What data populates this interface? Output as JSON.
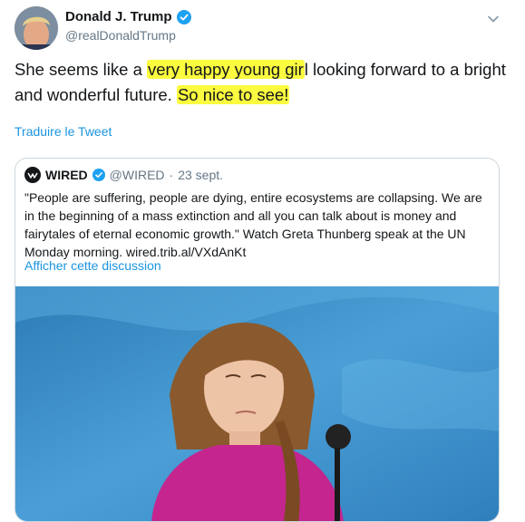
{
  "author": {
    "name": "Donald J. Trump",
    "handle": "@realDonaldTrump"
  },
  "tweet": {
    "part1": "She seems like a ",
    "highlight1": "very happy young gir",
    "part2": "l looking forward to a bright and wonderful future. ",
    "highlight2": "So nice to see!"
  },
  "translate_label": "Traduire le Tweet",
  "quoted": {
    "name": "WIRED",
    "handle": "@WIRED",
    "separator": "·",
    "date": "23 sept.",
    "text": "\"People are suffering, people are dying, entire ecosystems are collapsing. We are in the beginning of a mass extinction and all you can talk about is money and fairytales of eternal economic growth.\" Watch Greta Thunberg speak at the UN Monday morning. wired.trib.al/VXdAnKt",
    "show_thread_label": "Afficher cette discussion"
  },
  "colors": {
    "link": "#1b95e0",
    "verified": "#1da1f2",
    "highlight": "#fbfb3f",
    "media_background": "#3a8dc4",
    "shirt": "#c4258e"
  },
  "icons": {
    "verified": "verified-badge-icon",
    "chevron": "chevron-down-icon",
    "wired_logo": "wired-logo-icon"
  }
}
